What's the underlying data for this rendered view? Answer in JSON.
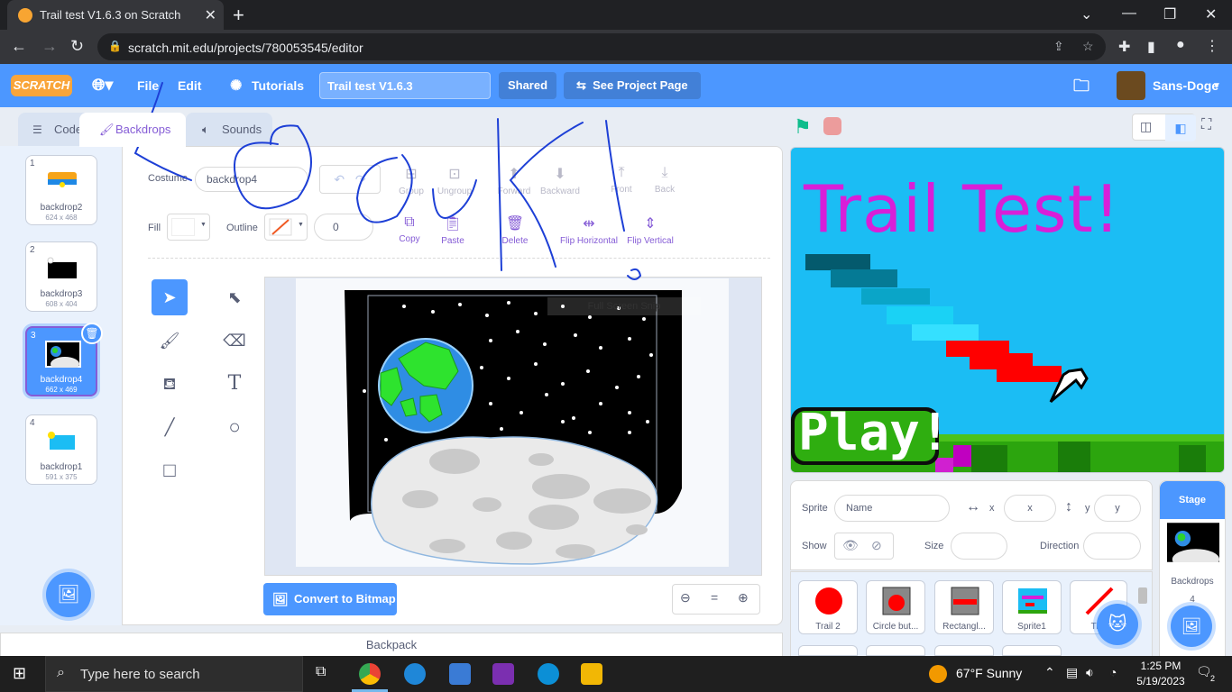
{
  "browser": {
    "tab_title": "Trail test V1.6.3 on Scratch",
    "new_tab": "+",
    "url": "scratch.mit.edu/projects/780053545/editor"
  },
  "menu": {
    "logo": "SCRATCH",
    "file": "File",
    "edit": "Edit",
    "tutorials": "Tutorials",
    "project_title": "Trail test V1.6.3",
    "shared": "Shared",
    "see_project": "See Project Page",
    "username": "Sans-Doge"
  },
  "editor_tabs": {
    "code": "Code",
    "backdrops": "Backdrops",
    "sounds": "Sounds"
  },
  "backdrops": [
    {
      "num": "1",
      "name": "backdrop2",
      "size": "624 x 468"
    },
    {
      "num": "2",
      "name": "backdrop3",
      "size": "608 x 404"
    },
    {
      "num": "3",
      "name": "backdrop4",
      "size": "662 x 469"
    },
    {
      "num": "4",
      "name": "backdrop1",
      "size": "591 x 375"
    }
  ],
  "paint": {
    "costume_label": "Costume",
    "costume_name": "backdrop4",
    "group": "Group",
    "ungroup": "Ungroup",
    "forward": "Forward",
    "backward": "Backward",
    "front": "Front",
    "back": "Back",
    "fill_label": "Fill",
    "outline_label": "Outline",
    "outline_width": "0",
    "copy": "Copy",
    "paste": "Paste",
    "delete": "Delete",
    "flip_h": "Flip Horizontal",
    "flip_v": "Flip Vertical",
    "convert": "Convert to Bitmap",
    "zoom_reset": "="
  },
  "backpack": "Backpack",
  "stage": {
    "title_text": "Trail Test!",
    "play_text": "Play!"
  },
  "sprite_info": {
    "sprite_label": "Sprite",
    "name_placeholder": "Name",
    "x_label": "x",
    "x_placeholder": "x",
    "y_label": "y",
    "y_placeholder": "y",
    "show_label": "Show",
    "size_label": "Size",
    "direction_label": "Direction"
  },
  "sprites": [
    {
      "name": "Trail 2"
    },
    {
      "name": "Circle but..."
    },
    {
      "name": "Rectangl..."
    },
    {
      "name": "Sprite1"
    },
    {
      "name": "Tr..."
    }
  ],
  "stage_pane": {
    "label": "Stage",
    "backdrops_label": "Backdrops",
    "backdrops_count": "4"
  },
  "taskbar": {
    "search_placeholder": "Type here to search",
    "weather": "67°F  Sunny",
    "time": "1:25 PM",
    "date": "5/19/2023",
    "notif": "2"
  },
  "overlay_text": "Full Screen Snip"
}
